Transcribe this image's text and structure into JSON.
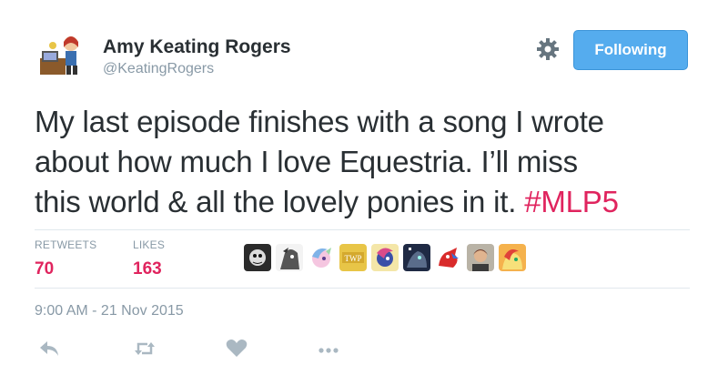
{
  "author": {
    "name": "Amy Keating Rogers",
    "handle": "@KeatingRogers"
  },
  "follow_button": {
    "label": "Following"
  },
  "tweet": {
    "lines": [
      "My last episode finishes with a song I wrote",
      "about how much I love Equestria. I’ll miss",
      "this world & all the lovely ponies in it. "
    ],
    "hashtag": "#MLP5"
  },
  "stats": {
    "retweets_label": "RETWEETS",
    "retweets_count": "70",
    "likes_label": "LIKES",
    "likes_count": "163"
  },
  "likers": [
    {
      "icon": "pony-avatar-dark"
    },
    {
      "icon": "pony-avatar-grey"
    },
    {
      "icon": "pony-avatar-pastel"
    },
    {
      "icon": "twp-logo-avatar",
      "text": "TWP"
    },
    {
      "icon": "pony-avatar-blue"
    },
    {
      "icon": "pony-avatar-night"
    },
    {
      "icon": "dragon-avatar-red"
    },
    {
      "icon": "person-avatar"
    },
    {
      "icon": "pony-avatar-yellow"
    }
  ],
  "timestamp": "9:00 AM - 21 Nov 2015",
  "colors": {
    "accent_blue": "#55acee",
    "hashtag_pink": "#e0245e",
    "muted_grey": "#8899a6"
  }
}
